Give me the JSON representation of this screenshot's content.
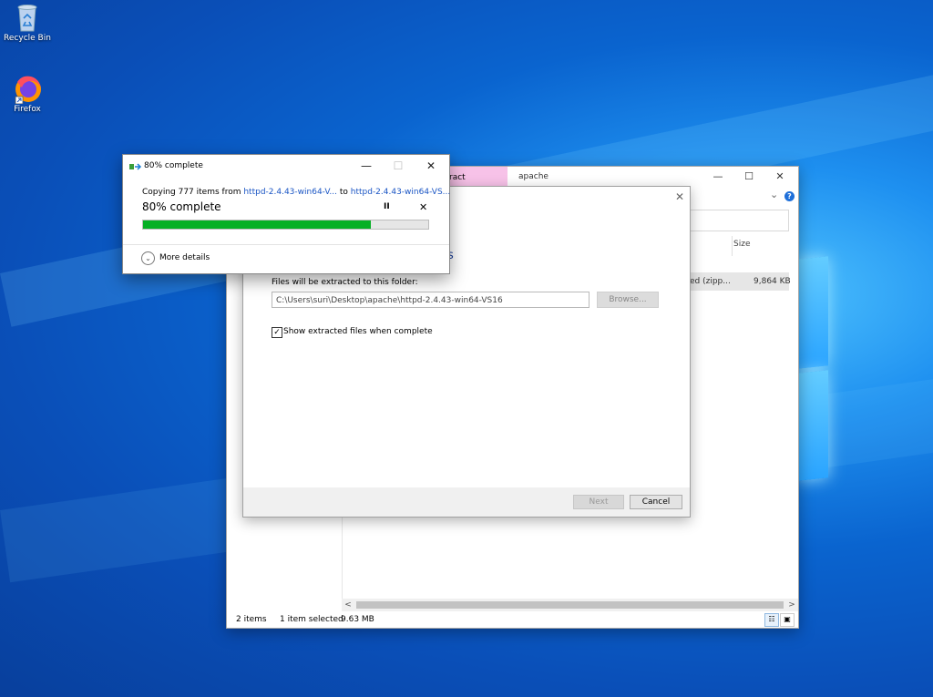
{
  "desktop": {
    "icons": [
      {
        "label": "Recycle Bin"
      },
      {
        "label": "Firefox"
      }
    ]
  },
  "explorer": {
    "tab_left_fragment": "ract",
    "tab_apache": "apache",
    "minimize": "—",
    "maximize": "☐",
    "close": "✕",
    "chevron": "⌄",
    "help": "?",
    "column_size": "Size",
    "row_type_fragment": "ed (zipp...",
    "row_size": "9,864 KB",
    "status_items": "2 items",
    "status_selected": "1 item selected",
    "status_size": "9.63 MB"
  },
  "wizard": {
    "close": "✕",
    "heading_fragment": "s",
    "label": "Files will be extracted to this folder:",
    "path": "C:\\Users\\suri\\Desktop\\apache\\httpd-2.4.43-win64-VS16",
    "browse": "Browse...",
    "checkbox_label": "Show extracted files when complete",
    "checkbox_checked": true,
    "next": "Next",
    "cancel": "Cancel"
  },
  "copy_dialog": {
    "title": "80% complete",
    "line_prefix": "Copying 777 items from ",
    "source": "httpd-2.4.43-win64-V...",
    "line_mid": " to ",
    "dest": "httpd-2.4.43-win64-VS...",
    "percent_text": "80% complete",
    "progress": 0.8,
    "pause": "II",
    "stop": "✕",
    "more_details": "More details",
    "minimize": "—",
    "maximize": "☐",
    "close": "✕"
  }
}
